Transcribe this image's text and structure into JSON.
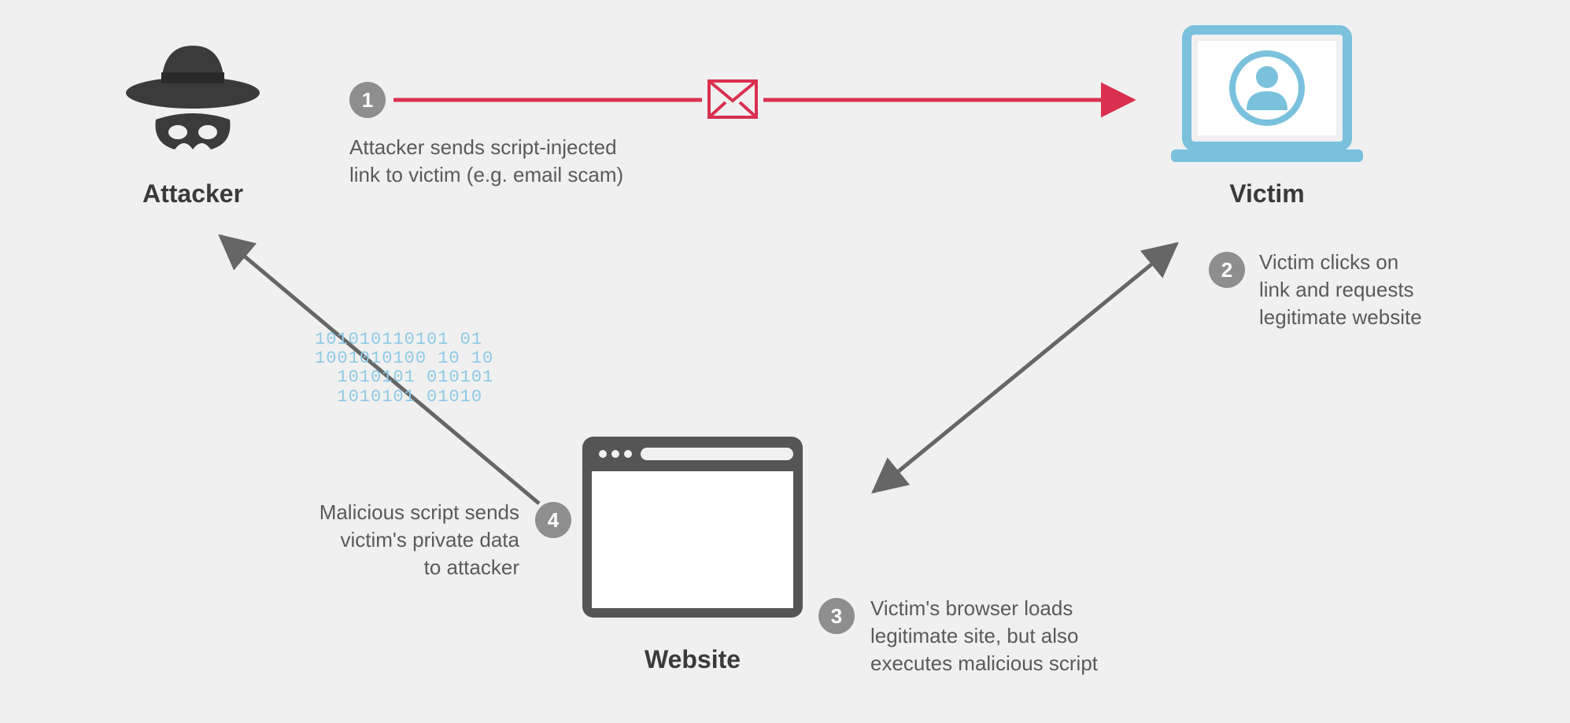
{
  "nodes": {
    "attacker": {
      "label": "Attacker"
    },
    "victim": {
      "label": "Victim"
    },
    "website": {
      "label": "Website"
    }
  },
  "steps": {
    "s1": {
      "num": "1",
      "text": "Attacker sends script-injected\nlink to victim (e.g. email scam)"
    },
    "s2": {
      "num": "2",
      "text": "Victim clicks on\nlink and requests\nlegitimate website"
    },
    "s3": {
      "num": "3",
      "text": "Victim's browser loads\nlegitimate site, but also\nexecutes malicious script"
    },
    "s4": {
      "num": "4",
      "text": "Malicious script sends\nvictim's private data\nto attacker"
    }
  },
  "decor": {
    "binary": "101010110101 01\n1001010100 10 10\n  1010101 010101\n  1010101 01010"
  },
  "colors": {
    "arrowGray": "#666666",
    "arrowRed": "#d9304f",
    "badgeGray": "#8e8e8e",
    "victimBlue": "#7ac1dd",
    "binaryBlue": "#8ec9e6",
    "textGray": "#5a5a5a",
    "iconDark": "#3b3b3b"
  }
}
